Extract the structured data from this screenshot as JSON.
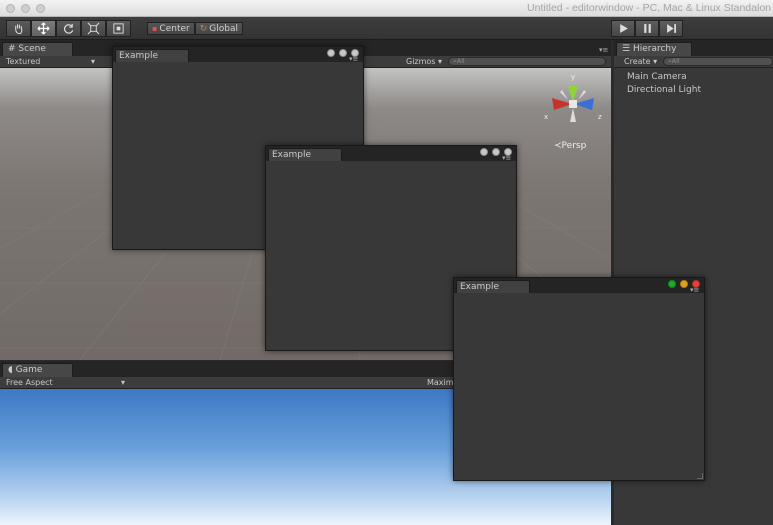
{
  "window": {
    "title": "Untitled - editorwindow - PC, Mac & Linux Standalon"
  },
  "toolbar": {
    "tools": [
      {
        "icon": "hand-icon"
      },
      {
        "icon": "move-icon"
      },
      {
        "icon": "rotate-icon"
      },
      {
        "icon": "scale-icon"
      },
      {
        "icon": "rect-tool-icon"
      }
    ],
    "pivot_label": "Center",
    "space_label": "Global",
    "playback": [
      {
        "icon": "play-icon"
      },
      {
        "icon": "pause-icon"
      },
      {
        "icon": "step-icon"
      }
    ]
  },
  "scene": {
    "tab_label": "Scene",
    "render_mode": "Textured",
    "gizmos_label": "Gizmos",
    "search_placeholder": "All",
    "gizmo_axes": {
      "y": "y",
      "x": "x",
      "z": "z"
    },
    "projection_label": "Persp"
  },
  "game": {
    "tab_label": "Game",
    "aspect_label": "Free Aspect",
    "maximize_label": "Maximi"
  },
  "hierarchy": {
    "tab_label": "Hierarchy",
    "create_label": "Create",
    "search_placeholder": "All",
    "items": [
      {
        "label": "Main Camera"
      },
      {
        "label": "Directional Light"
      }
    ]
  },
  "example_windows": [
    {
      "title": "Example"
    },
    {
      "title": "Example"
    },
    {
      "title": "Example"
    }
  ],
  "colors": {
    "close": "#e0443e",
    "minimize": "#dea123",
    "zoom": "#1aab29",
    "axis_x": "#c8322a",
    "axis_y": "#8fd43a",
    "axis_z": "#3a6fd8"
  }
}
